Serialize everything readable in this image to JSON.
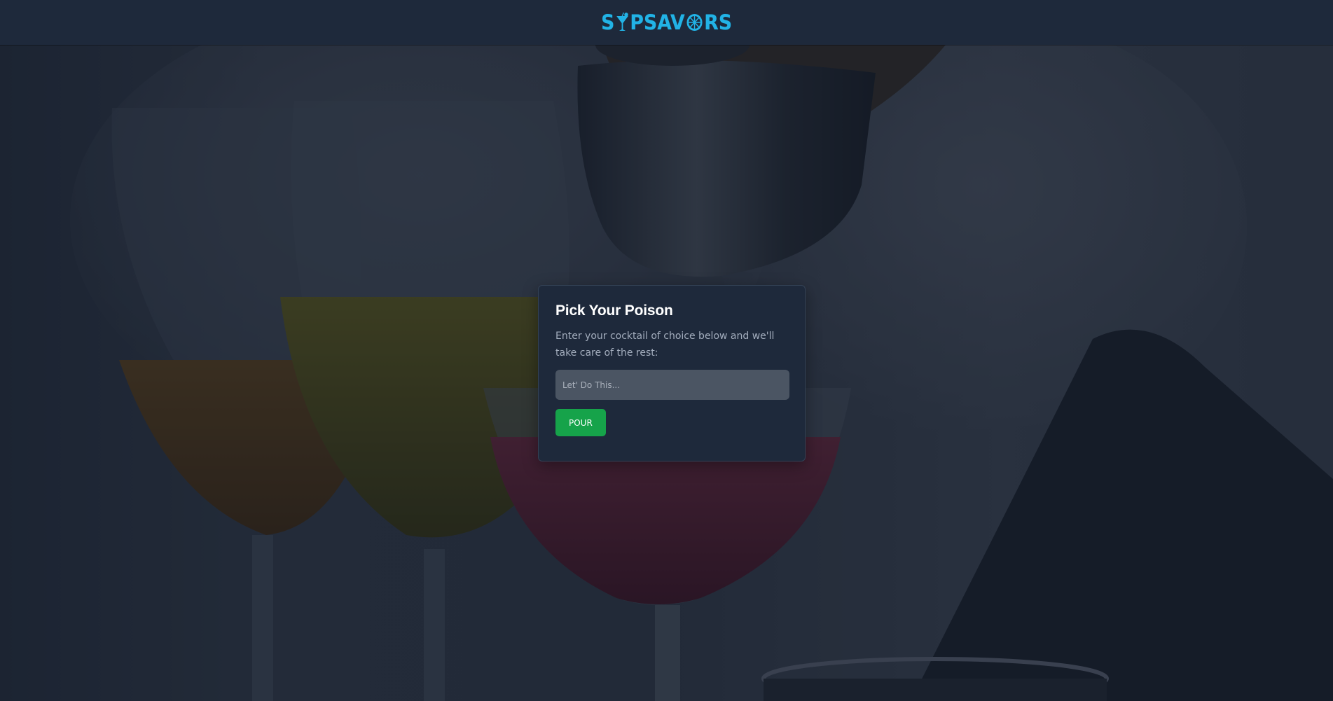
{
  "header": {
    "logo_text_before": "S",
    "logo_text_middle": "PSAV",
    "logo_text_after": "RS",
    "logo_icons": [
      "cocktail-glass-icon",
      "citrus-slice-icon"
    ],
    "brand_color": "#22b3e6"
  },
  "hero": {
    "background_description_icon": "cocktail-pour-photo"
  },
  "card": {
    "title": "Pick Your Poison",
    "subtitle": "Enter your cocktail of choice below and we'll take care of the rest:",
    "input_placeholder": "Let' Do This...",
    "input_value": "",
    "button_label": "POUR",
    "button_color": "#16a34a"
  }
}
